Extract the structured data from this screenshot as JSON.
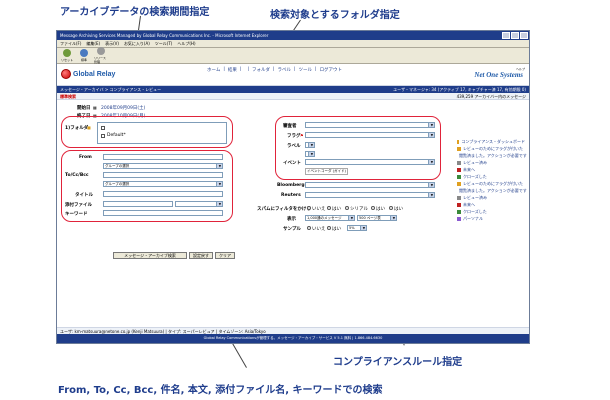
{
  "callouts": {
    "period": "アーカイブデータの検索期間指定",
    "folder": "検索対象とするフォルダ指定",
    "compliance": "コンプライアンスルール指定",
    "fields": "From, To, Cc, Bcc, 件名, 本文, 添付ファイル名, キーワードでの検索"
  },
  "window": {
    "title": "Message Archiving Services Managed by Global Relay Communications Inc. - Microsoft Internet Explorer",
    "menu": [
      "ファイル(F)",
      "編集(E)",
      "表示(V)",
      "お気に入り(A)",
      "ツール(T)",
      "ヘルプ(H)"
    ],
    "toolbar": [
      "リセット",
      "標準",
      "リリース管理"
    ]
  },
  "brand": {
    "logo": "Global Relay",
    "partner": "Net One Systems",
    "nav": [
      "ホーム",
      "|",
      "結果",
      "|",
      "",
      "|",
      "フォルダ",
      "|",
      "ラベル",
      "|",
      "ツール",
      "|",
      "ログアウト"
    ],
    "help": "ヘルプ"
  },
  "bars": {
    "crumb": "メッセージ・アーカイバ > コンプライアンス・レビュー",
    "user": "ユーザ・マネージャ: 34 (アクティブ 17, キャプチャー済 17, 有効期限 0)",
    "section": "標準検索",
    "count": "439,259 アーカイバー内のメッセージ"
  },
  "form": {
    "start_label": "開始日",
    "start_value": "2008年09月09日(土)",
    "end_label": "終了日",
    "end_value": "2008年10月09日(月)",
    "folder_label": "1)フォルダ",
    "folder_items": [
      "",
      "Default*"
    ],
    "from_label": "From",
    "group_select": "グループの選択",
    "to_label": "To/Cc/Bcc",
    "title_label": "タイトル",
    "attach_label": "添付ファイル",
    "keyword_label": "キーワード",
    "search_btn": "メッセージ・アーカイブ検索",
    "reset_btn": "設定戻す",
    "clear_btn": "クリア"
  },
  "compliance": {
    "reviewer_label": "審査者",
    "flag_label": "フラグ",
    "label_label": "ラベル",
    "event_label": "イベント",
    "event_value": "",
    "event_hint": "イベントコーダ (ガイド)",
    "bloomberg_label": "Bloomberg",
    "reuters_label": "Reuters",
    "spam_label": "スパムにフィルタをかける",
    "spam_opts": [
      "いいえ",
      "はい",
      "シリアル",
      "はい",
      "はい"
    ],
    "display_label": "表示",
    "display_value": "1,000通のメッセージ",
    "page_value": "500 ページ表",
    "sample_label": "サンプル",
    "sample_opts": [
      "いいえ",
      "はい"
    ],
    "sample_value": "5%"
  },
  "dashboard": {
    "title": "コンプライアンス・ダッシュボード",
    "items": [
      "レビューのためにフラグが付いた",
      "閲覧済ました。アクションが必要です",
      "レビュー済み",
      "未来へ",
      "クローズした",
      "レビューのためにフラグが付いた",
      "閲覧済ました。アクションが必要です",
      "レビュー済み",
      "未来へ",
      "クローズした",
      "パーソナル"
    ],
    "colors": [
      "#e0a020",
      "#3a7ad0",
      "#888888",
      "#c02020",
      "#3a8a3a",
      "#e0a020",
      "#3a7ad0",
      "#888888",
      "#c02020",
      "#3a8a3a",
      "#8a5ad0"
    ]
  },
  "status": {
    "user": "ユーザ: km-matsuura@netone.co.jp (Kenji Matsuura) | タイプ: スーパーレビュア | タイムゾーン: Asia/Tokyo"
  },
  "footer": "Global Relay Communicationsが管理する。メッセージ・アーカイブ・サービス V 5.1 無料 | 1.866.484.6630"
}
